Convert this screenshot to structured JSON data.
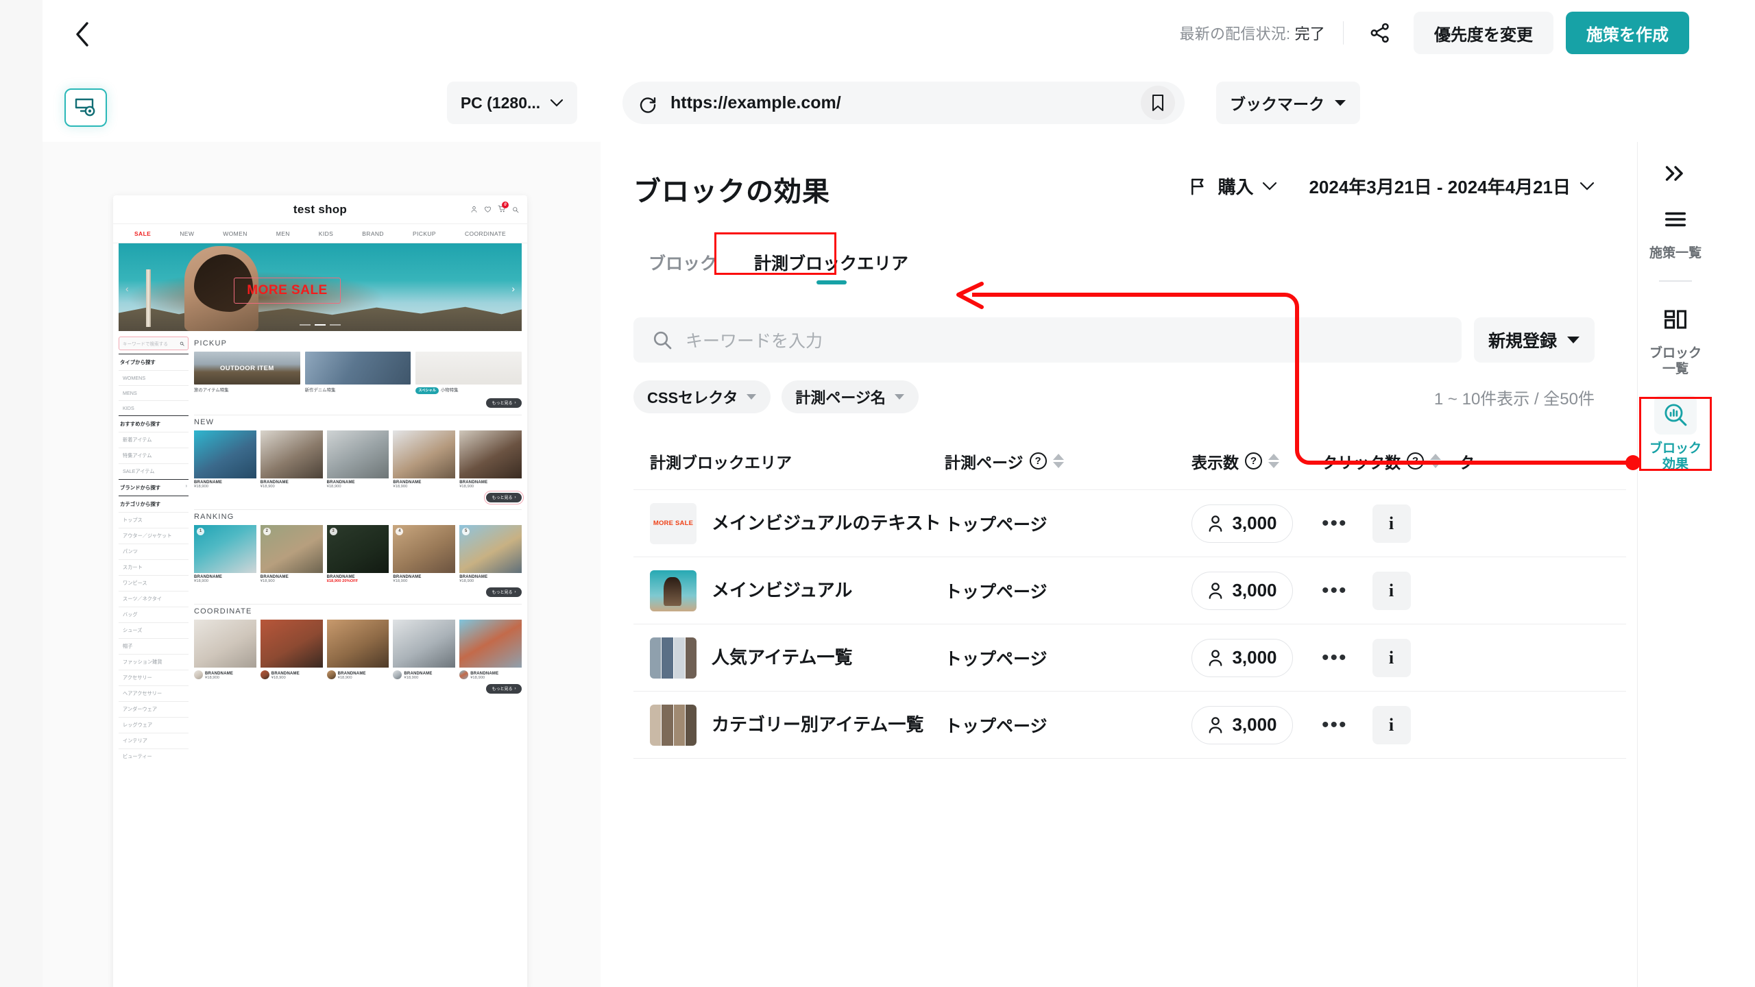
{
  "topbar": {
    "back_icon": "chevron-left-icon",
    "status_label": "最新の配信状況:",
    "status_value": "完了",
    "share_icon": "share-icon",
    "priority_button": "優先度を変更",
    "create_button": "施策を作成"
  },
  "urlbar": {
    "preview_icon": "screen-preview-icon",
    "device": "PC (1280...",
    "reload_icon": "reload-icon",
    "url": "https://example.com/",
    "bookmark_icon": "bookmark-icon",
    "bookmark_select": "ブックマーク"
  },
  "preview": {
    "shop_title": "test shop",
    "cart_badge": "0",
    "nav": [
      "SALE",
      "NEW",
      "WOMEN",
      "MEN",
      "KIDS",
      "BRAND",
      "PICKUP",
      "COORDINATE"
    ],
    "hero_text": "MORE SALE",
    "search_placeholder": "キーワードで検索する",
    "side_nav": [
      {
        "type": "group",
        "label": "タイプから探す"
      },
      {
        "type": "item",
        "label": "WOMENS"
      },
      {
        "type": "item",
        "label": "MENS"
      },
      {
        "type": "item",
        "label": "KIDS"
      },
      {
        "type": "group",
        "label": "おすすめから探す"
      },
      {
        "type": "item",
        "label": "新着アイテム"
      },
      {
        "type": "item",
        "label": "特集アイテム"
      },
      {
        "type": "item",
        "label": "SALEアイテム"
      },
      {
        "type": "group",
        "label": "ブランドから探す",
        "arrow": "›"
      },
      {
        "type": "group",
        "label": "カテゴリから探す"
      },
      {
        "type": "item",
        "label": "トップス"
      },
      {
        "type": "item",
        "label": "アウター／ジャケット"
      },
      {
        "type": "item",
        "label": "パンツ"
      },
      {
        "type": "item",
        "label": "スカート"
      },
      {
        "type": "item",
        "label": "ワンピース"
      },
      {
        "type": "item",
        "label": "スーツ／ネクタイ"
      },
      {
        "type": "item",
        "label": "バッグ"
      },
      {
        "type": "item",
        "label": "シューズ"
      },
      {
        "type": "item",
        "label": "帽子"
      },
      {
        "type": "item",
        "label": "ファッション雑貨"
      },
      {
        "type": "item",
        "label": "アクセサリー"
      },
      {
        "type": "item",
        "label": "ヘアアクセサリー"
      },
      {
        "type": "item",
        "label": "アンダーウェア"
      },
      {
        "type": "item",
        "label": "レッグウェア"
      },
      {
        "type": "item",
        "label": "インテリア"
      },
      {
        "type": "item",
        "label": "ビューティー"
      }
    ],
    "sections": {
      "pickup": {
        "title": "PICKUP",
        "more": "もっと見る",
        "cards": [
          {
            "caption": "旅のアイテム特集",
            "overlay": "OUTDOOR ITEM"
          },
          {
            "caption": "新作デニム特集",
            "overlay": ""
          },
          {
            "caption": "小物特集",
            "tag": "スペシャル",
            "overlay": ""
          }
        ]
      },
      "new": {
        "title": "NEW",
        "more": "もっと見る",
        "products": [
          {
            "name": "BRANDNAME",
            "price": "¥18,900"
          },
          {
            "name": "BRANDNAME",
            "price": "¥18,900"
          },
          {
            "name": "BRANDNAME",
            "price": "¥18,900"
          },
          {
            "name": "BRANDNAME",
            "price": "¥18,900"
          },
          {
            "name": "BRANDNAME",
            "price": "¥18,900"
          }
        ]
      },
      "ranking": {
        "title": "RANKING",
        "more": "もっと見る",
        "products": [
          {
            "rank": "1",
            "name": "BRANDNAME",
            "price": "¥18,900"
          },
          {
            "rank": "2",
            "name": "BRANDNAME",
            "price": "¥18,900"
          },
          {
            "rank": "3",
            "name": "BRANDNAME",
            "price": "¥18,900 20%OFF",
            "sale": true
          },
          {
            "rank": "4",
            "name": "BRANDNAME",
            "price": "¥18,900"
          },
          {
            "rank": "5",
            "name": "BRANDNAME",
            "price": "¥18,900"
          }
        ]
      },
      "coordinate": {
        "title": "COORDINATE",
        "more": "もっと見る",
        "products": [
          {
            "name": "BRANDNAME",
            "price": "¥18,900"
          },
          {
            "name": "BRANDNAME",
            "price": "¥18,900"
          },
          {
            "name": "BRANDNAME",
            "price": "¥18,900"
          },
          {
            "name": "BRANDNAME",
            "price": "¥18,900"
          },
          {
            "name": "BRANDNAME",
            "price": "¥18,900"
          }
        ]
      }
    }
  },
  "main": {
    "title": "ブロックの効果",
    "goal_icon": "flag-icon",
    "goal": "購入",
    "date_range": "2024年3月21日 - 2024年4月21日",
    "tabs": [
      {
        "label": "ブロック",
        "active": false
      },
      {
        "label": "計測ブロックエリア",
        "active": true
      }
    ],
    "search_placeholder": "キーワードを入力",
    "search_icon": "search-icon",
    "new_register": "新規登録",
    "filters": [
      {
        "label": "CSSセレクタ"
      },
      {
        "label": "計測ページ名"
      }
    ],
    "result_count": "1 ~ 10件表示 / 全50件",
    "table": {
      "columns": [
        {
          "label": "計測ブロックエリア",
          "help": false,
          "sort": false
        },
        {
          "label": "計測ページ",
          "help": true,
          "sort": true
        },
        {
          "label": "表示数",
          "help": true,
          "sort": true
        },
        {
          "label": "クリック数",
          "help": true,
          "sort": true
        },
        {
          "label": "ク",
          "help": false,
          "sort": false
        }
      ],
      "rows": [
        {
          "name": "メインビジュアルのテキスト",
          "page": "トップページ",
          "views": "3,000",
          "thumb": "sale-text",
          "menu_icon": "more-horizontal-icon",
          "info_icon": "info-icon"
        },
        {
          "name": "メインビジュアル",
          "page": "トップページ",
          "views": "3,000",
          "thumb": "main-visual",
          "menu_icon": "more-horizontal-icon",
          "info_icon": "info-icon"
        },
        {
          "name": "人気アイテム一覧",
          "page": "トップページ",
          "views": "3,000",
          "thumb": "item-grid",
          "menu_icon": "more-horizontal-icon",
          "info_icon": "info-icon"
        },
        {
          "name": "カテゴリー別アイテム一覧",
          "page": "トップページ",
          "views": "3,000",
          "thumb": "category-grid",
          "menu_icon": "more-horizontal-icon",
          "info_icon": "info-icon"
        }
      ]
    }
  },
  "rail": {
    "expand_icon": "chevrons-right-icon",
    "items": [
      {
        "label": "施策一覧",
        "icon": "list-icon",
        "active": false
      },
      {
        "label": "ブロック\n一覧",
        "label_l1": "ブロック",
        "label_l2": "一覧",
        "icon": "blocks-icon",
        "active": false
      },
      {
        "label": "ブロック\n効果",
        "label_l1": "ブロック",
        "label_l2": "効果",
        "icon": "chart-search-icon",
        "active": true
      }
    ]
  },
  "colors": {
    "accent": "#17a2a6",
    "annotation": "#fb0b0b",
    "muted": "#8a8f95"
  }
}
